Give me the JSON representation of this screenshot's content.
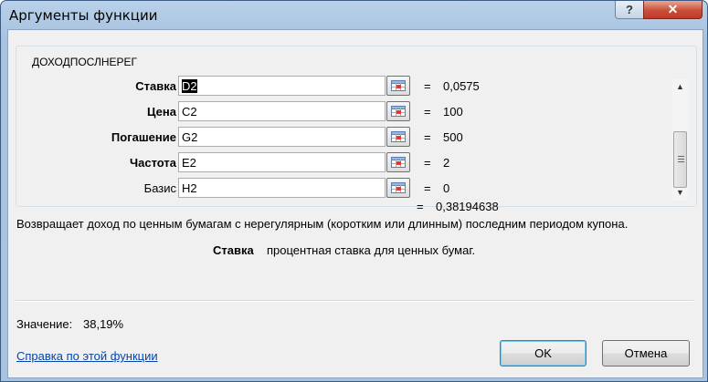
{
  "window": {
    "title": "Аргументы функции",
    "help_label": "?",
    "close_label": "✕"
  },
  "function_name": "ДОХОДПОСЛНЕРЕГ",
  "args": [
    {
      "label": "Ставка",
      "value_selected": "D2",
      "value_rest": "",
      "result": "0,0575",
      "bold": true
    },
    {
      "label": "Цена",
      "value_selected": "",
      "value_rest": "C2",
      "result": "100",
      "bold": true
    },
    {
      "label": "Погашение",
      "value_selected": "",
      "value_rest": "G2",
      "result": "500",
      "bold": true
    },
    {
      "label": "Частота",
      "value_selected": "",
      "value_rest": "E2",
      "result": "2",
      "bold": true
    },
    {
      "label": "Базис",
      "value_selected": "",
      "value_rest": "H2",
      "result": "0",
      "bold": false
    }
  ],
  "equals": "=",
  "formula_result": "0,38194638",
  "description": "Возвращает доход по ценным бумагам с нерегулярным (коротким или длинным) последним периодом купона.",
  "arg_help": {
    "name": "Ставка",
    "text": "процентная ставка для ценных бумаг."
  },
  "value": {
    "label": "Значение:",
    "value": "38,19%"
  },
  "help_link": "Справка по этой функции",
  "buttons": {
    "ok": "OK",
    "cancel": "Отмена"
  },
  "icons": {
    "ref_button": "collapse-range-icon",
    "scroll_up": "▲",
    "scroll_down": "▼"
  }
}
